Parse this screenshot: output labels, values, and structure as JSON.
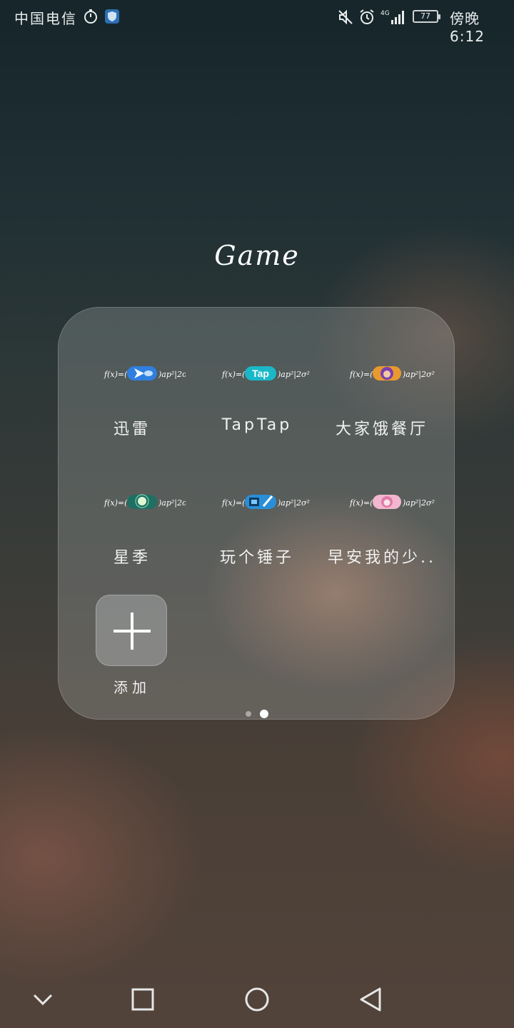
{
  "status_bar": {
    "carrier": "中国电信",
    "battery_level": "77",
    "time": "傍晚6:12",
    "network": "4G",
    "icons": [
      "timer-icon",
      "shield-icon",
      "mute-icon",
      "alarm-icon",
      "signal-icon",
      "battery-icon"
    ]
  },
  "folder": {
    "title": "Game",
    "apps": [
      {
        "label": "迅雷",
        "icon": "xunlei-icon"
      },
      {
        "label": "TapTap",
        "icon": "taptap-icon",
        "icon_text": "Tap"
      },
      {
        "label": "大家饿餐厅",
        "icon": "restaurant-game-icon"
      },
      {
        "label": "星季",
        "icon": "xingji-icon"
      },
      {
        "label": "玩个锤子",
        "icon": "hammer-game-icon"
      },
      {
        "label": "早安我的少..",
        "icon": "morning-girl-game-icon"
      }
    ],
    "add_label": "添加",
    "pages": {
      "current": 2,
      "total": 2
    }
  },
  "nav_bar": {
    "buttons": [
      "collapse-icon",
      "recents-icon",
      "home-icon",
      "back-icon"
    ]
  },
  "colors": {
    "panel": "#cfd5d5",
    "text": "#ffffff",
    "taptap": "#19b8c8",
    "xunlei": "#2f7fe0"
  }
}
